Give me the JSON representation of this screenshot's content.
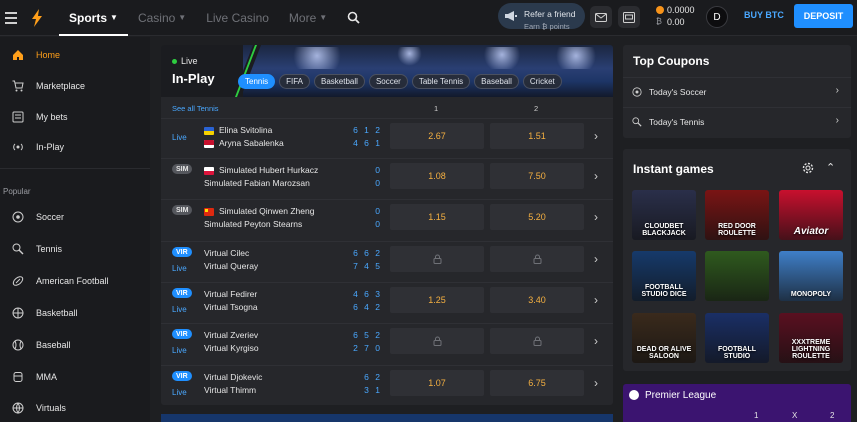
{
  "nav": {
    "sports": "Sports",
    "casino": "Casino",
    "live_casino": "Live Casino",
    "more": "More"
  },
  "refer": {
    "line1": "Refer a friend",
    "line2": "Earn ₿ points"
  },
  "balance": {
    "btc": "0.0000",
    "other": "0.00"
  },
  "avatar_letter": "D",
  "buy_btc": "BUY BTC",
  "deposit": "DEPOSIT",
  "sidebar": {
    "items": [
      {
        "label": "Home"
      },
      {
        "label": "Marketplace"
      },
      {
        "label": "My bets"
      },
      {
        "label": "In-Play"
      }
    ],
    "popular_heading": "Popular",
    "popular": [
      {
        "label": "Soccer"
      },
      {
        "label": "Tennis"
      },
      {
        "label": "American Football"
      },
      {
        "label": "Basketball"
      },
      {
        "label": "Baseball"
      },
      {
        "label": "MMA"
      },
      {
        "label": "Virtuals"
      }
    ]
  },
  "inplay": {
    "live_label": "Live",
    "title": "In-Play",
    "tabs": [
      "Tennis",
      "FIFA",
      "Basketball",
      "Soccer",
      "Table Tennis",
      "Baseball",
      "Cricket"
    ],
    "see_all": "See all Tennis",
    "col1": "1",
    "col2": "2",
    "matches": [
      {
        "status": "Live",
        "badge": "",
        "team1": "Elina Svitolina",
        "team2": "Aryna Sabalenka",
        "score1": "6 1 2",
        "score2": "4 6 1",
        "odd1": "2.67",
        "odd2": "1.51"
      },
      {
        "status": "",
        "badge": "SIM",
        "team1": "Simulated Hubert Hurkacz",
        "team2": "Simulated Fabian Marozsan",
        "score1": "0",
        "score2": "0",
        "odd1": "1.08",
        "odd2": "7.50"
      },
      {
        "status": "",
        "badge": "SIM",
        "team1": "Simulated Qinwen Zheng",
        "team2": "Simulated Peyton Stearns",
        "score1": "0",
        "score2": "0",
        "odd1": "1.15",
        "odd2": "5.20"
      },
      {
        "status": "Live",
        "badge": "VIR",
        "team1": "Virtual Cilec",
        "team2": "Virtual Queray",
        "score1": "6 6 2",
        "score2": "7 4 5",
        "odd1": "",
        "odd2": ""
      },
      {
        "status": "Live",
        "badge": "VIR",
        "team1": "Virtual Fedirer",
        "team2": "Virtual Tsogna",
        "score1": "4 6 3",
        "score2": "6 4 2",
        "odd1": "1.25",
        "odd2": "3.40"
      },
      {
        "status": "Live",
        "badge": "VIR",
        "team1": "Virtual Zveriev",
        "team2": "Virtual Kyrgiso",
        "score1": "6 5 2",
        "score2": "2 7 0",
        "odd1": "",
        "odd2": ""
      },
      {
        "status": "Live",
        "badge": "VIR",
        "team1": "Virtual Djokevic",
        "team2": "Virtual Thimm",
        "score1": "6 2",
        "score2": "3 1",
        "odd1": "1.07",
        "odd2": "6.75"
      }
    ]
  },
  "coupons": {
    "title": "Top Coupons",
    "items": [
      {
        "label": "Today's Soccer"
      },
      {
        "label": "Today's Tennis"
      }
    ]
  },
  "instant": {
    "title": "Instant games",
    "games": [
      {
        "label": "CLOUDBET BLACKJACK",
        "bg": "#2a2f4a"
      },
      {
        "label": "RED DOOR ROULETTE",
        "bg": "#7a1414"
      },
      {
        "label": "Aviator",
        "bg": "#c8102e"
      },
      {
        "label": "FOOTBALL STUDIO DICE",
        "bg": "#163a6b"
      },
      {
        "label": "",
        "bg": "#2f5a1e"
      },
      {
        "label": "MONOPOLY",
        "bg": "#3f7fc8"
      },
      {
        "label": "DEAD OR ALIVE SALOON",
        "bg": "#3a2a1c"
      },
      {
        "label": "FOOTBALL STUDIO",
        "bg": "#1a2f66"
      },
      {
        "label": "XXXTREME LIGHTNING ROULETTE",
        "bg": "#5a1020"
      }
    ]
  },
  "premier": {
    "title": "Premier League",
    "h1": "1",
    "hx": "X",
    "h2": "2"
  },
  "colors": {
    "accent": "#1f8fff",
    "home_active": "#ff9f1a",
    "odds": "#f5b041"
  }
}
